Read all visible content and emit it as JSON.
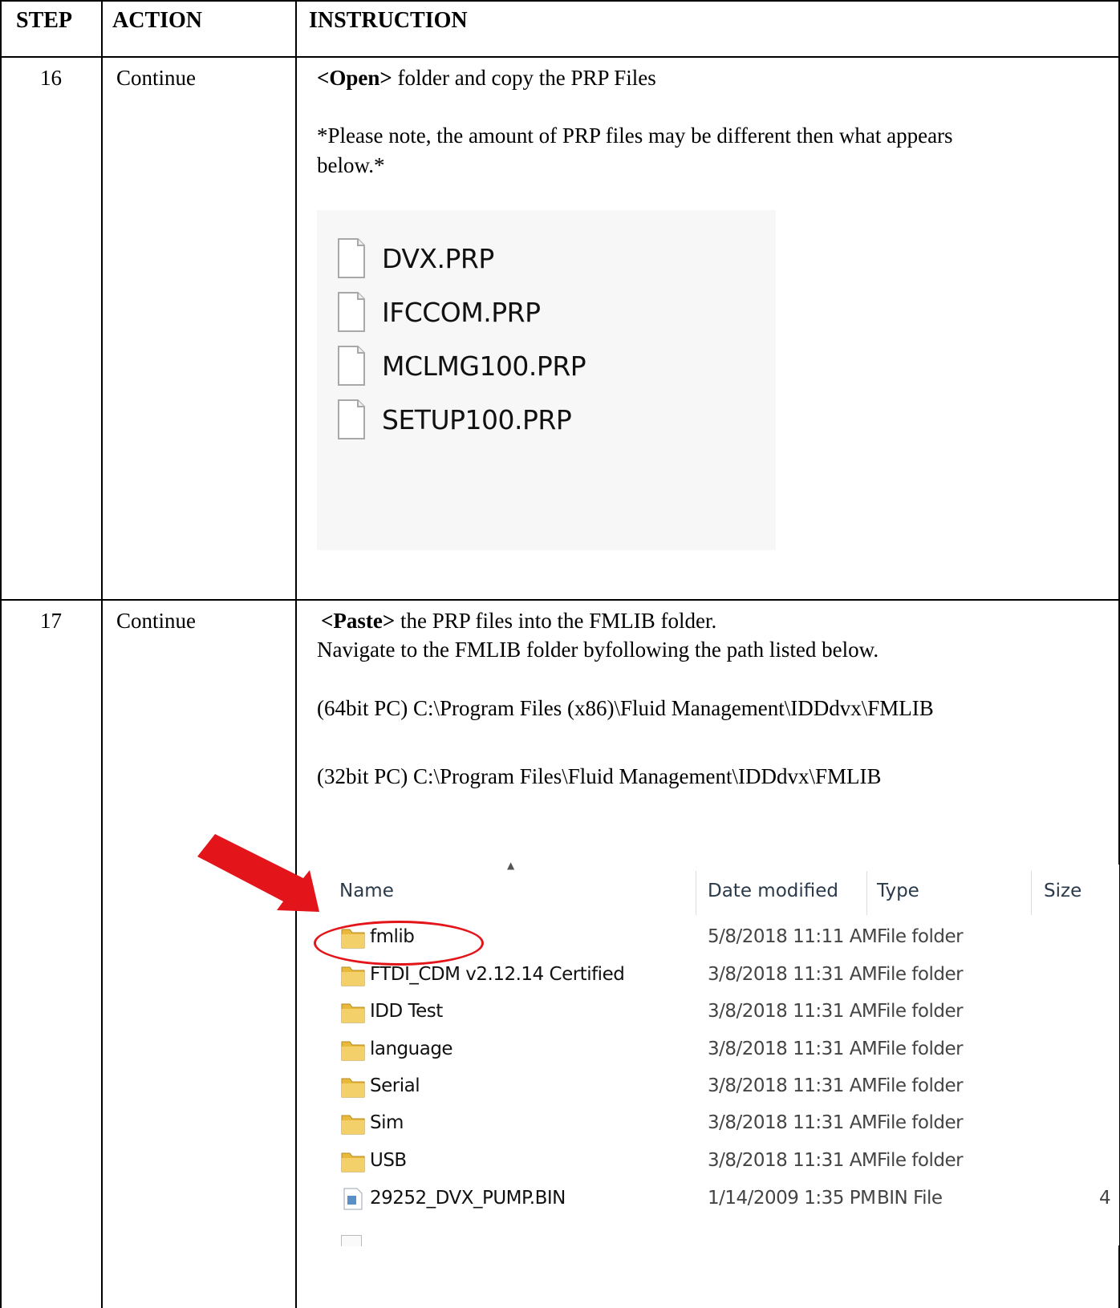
{
  "table": {
    "headers": {
      "step": "STEP",
      "action": "ACTION",
      "instruction": "INSTRUCTION"
    },
    "rows": [
      {
        "step": "16",
        "action": "Continue",
        "line1_bold": "<Open>",
        "line1_rest": " folder and copy the PRP Files",
        "note_line1": "*Please note, the amount of PRP files may be different then what appears",
        "note_line2": "below.*",
        "files": [
          "DVX.PRP",
          "IFCCOM.PRP",
          "MCLMG100.PRP",
          "SETUP100.PRP"
        ]
      },
      {
        "step": "17",
        "action": "Continue",
        "line1_bold": "<Paste>",
        "line1_rest": " the PRP files into the FMLIB folder.",
        "line2": "Navigate to the FMLIB folder byfollowing the path listed below.",
        "path64": "(64bit PC) C:\\Program Files (x86)\\Fluid Management\\IDDdvx\\FMLIB",
        "path32": "(32bit PC) C:\\Program Files\\Fluid Management\\IDDdvx\\FMLIB"
      }
    ]
  },
  "explorer": {
    "columns": {
      "name": "Name",
      "date": "Date modified",
      "type": "Type",
      "size": "Size"
    },
    "items": [
      {
        "name": "fmlib",
        "date": "5/8/2018 11:11 AM",
        "type": "File folder",
        "size": "",
        "icon": "folder-icon"
      },
      {
        "name": "FTDI_CDM v2.12.14 Certified",
        "date": "3/8/2018 11:31 AM",
        "type": "File folder",
        "size": "",
        "icon": "folder-icon"
      },
      {
        "name": "IDD Test",
        "date": "3/8/2018 11:31 AM",
        "type": "File folder",
        "size": "",
        "icon": "folder-icon"
      },
      {
        "name": "language",
        "date": "3/8/2018 11:31 AM",
        "type": "File folder",
        "size": "",
        "icon": "folder-icon"
      },
      {
        "name": "Serial",
        "date": "3/8/2018 11:31 AM",
        "type": "File folder",
        "size": "",
        "icon": "folder-icon"
      },
      {
        "name": "Sim",
        "date": "3/8/2018 11:31 AM",
        "type": "File folder",
        "size": "",
        "icon": "folder-icon"
      },
      {
        "name": "USB",
        "date": "3/8/2018 11:31 AM",
        "type": "File folder",
        "size": "",
        "icon": "folder-icon"
      },
      {
        "name": "29252_DVX_PUMP.BIN",
        "date": "1/14/2009 1:35 PM",
        "type": "BIN File",
        "size": "4",
        "icon": "bin-file-icon"
      }
    ]
  },
  "colors": {
    "border": "#000000",
    "highlight": "#e3151a",
    "folder": "#e8b93c"
  }
}
